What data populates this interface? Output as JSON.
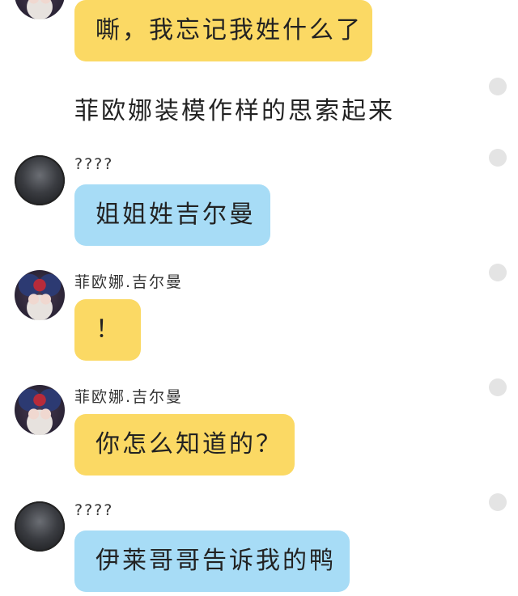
{
  "messages": [
    {
      "sender": "",
      "text": "嘶，我忘记我姓什么了",
      "color": "yellow"
    },
    {
      "narration": "菲欧娜装模作样的思索起来"
    },
    {
      "sender": "????",
      "text": "姐姐姓吉尔曼",
      "color": "blue"
    },
    {
      "sender": "菲欧娜.吉尔曼",
      "text": "！",
      "color": "yellow"
    },
    {
      "sender": "菲欧娜.吉尔曼",
      "text": "你怎么知道的？",
      "color": "yellow"
    },
    {
      "sender": "????",
      "text": "伊莱哥哥告诉我的鸭",
      "color": "blue"
    }
  ],
  "colors": {
    "yellow": "#fbd964",
    "blue": "#a7dcf6",
    "dot": "#e4e4e4"
  }
}
